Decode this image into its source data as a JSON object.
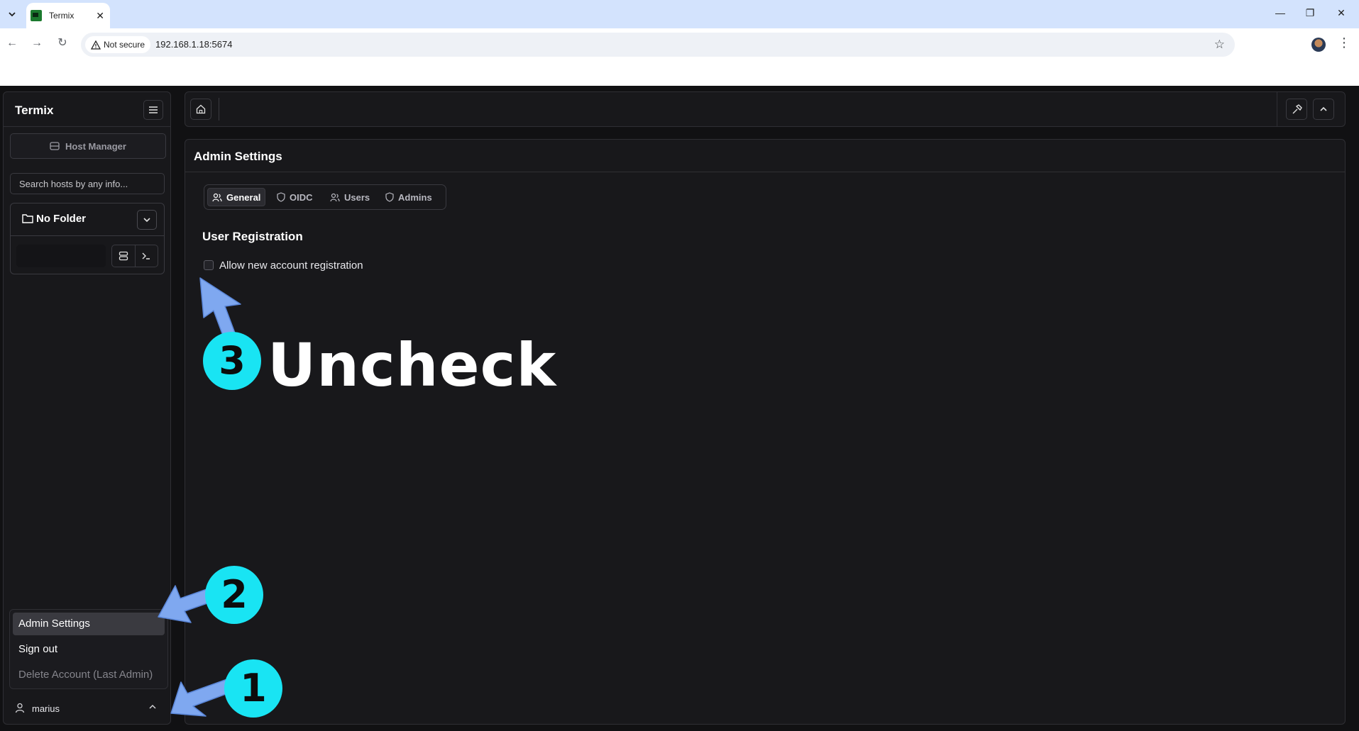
{
  "browser": {
    "tab_title": "Termix",
    "security_label": "Not secure",
    "url": "192.168.1.18:5674",
    "window_controls": {
      "minimize": "—",
      "maximize": "❐",
      "close": "✕"
    }
  },
  "sidebar": {
    "title": "Termix",
    "host_manager_label": "Host Manager",
    "search_placeholder": "Search hosts by any info...",
    "folder_name": "No Folder",
    "user_menu": {
      "items": [
        {
          "label": "Admin Settings",
          "state": "highlighted"
        },
        {
          "label": "Sign out",
          "state": "normal"
        },
        {
          "label": "Delete Account (Last Admin)",
          "state": "disabled"
        }
      ]
    },
    "username": "marius"
  },
  "main": {
    "title": "Admin Settings",
    "tabs": [
      {
        "label": "General",
        "icon": "users-icon",
        "active": true
      },
      {
        "label": "OIDC",
        "icon": "shield-icon",
        "active": false
      },
      {
        "label": "Users",
        "icon": "users-icon",
        "active": false
      },
      {
        "label": "Admins",
        "icon": "shield-icon",
        "active": false
      }
    ],
    "section_title": "User Registration",
    "registration_label": "Allow new account registration",
    "registration_checked": false
  },
  "annotations": {
    "step1": "1",
    "step2": "2",
    "step3": "3",
    "step3_text": "Uncheck",
    "badge_color": "#19e4f3",
    "arrow_color": "#7fa8f0"
  }
}
